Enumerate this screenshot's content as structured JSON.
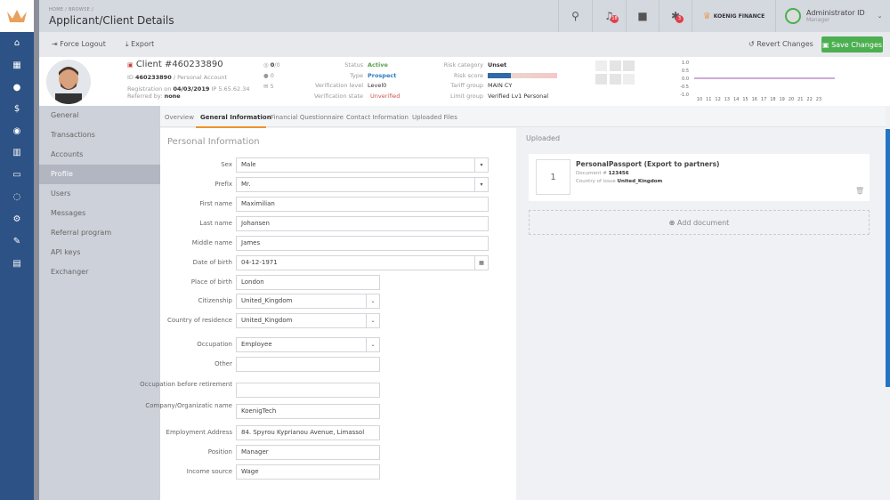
{
  "header": {
    "breadcrumb": "HOME / BROWSE /",
    "title": "Applicant/Client Details",
    "notifications_badge": "18",
    "alerts_badge": "3",
    "brand": "KOENIG FINANCE",
    "user_name": "Administrator ID",
    "user_role": "Manager"
  },
  "toolbar": {
    "force_logout": "Force Logout",
    "export": "Export",
    "revert": "Revert Changes",
    "save": "Save Changes"
  },
  "client": {
    "title": "Client #460233890",
    "id_label": "ID",
    "id": "460233890",
    "account_type": "/ Personal Account",
    "registration_label": "Registration on",
    "registration_date": "04/03/2019",
    "ip": "IP 5.65.62.34",
    "referred_label": "Referred by:",
    "referred": "none",
    "stat1": "0",
    "stat1_sub": "/0",
    "stat2": "0",
    "stat3": "5",
    "status_label": "Status",
    "status": "Active",
    "type_label": "Type",
    "type": "Prospect",
    "verification_level_label": "Verification level",
    "verification_level": "Level0",
    "verification_state_label": "Verification state",
    "verification_state": "Unverified",
    "risk_category_label": "Risk category",
    "risk_category": "Unset",
    "risk_score_label": "Risk score",
    "risk_score_fraction": 0.33,
    "tariff_label": "Tariff group",
    "tariff": "MAIN CY",
    "limit_label": "Limit group",
    "limit": "Verified Lv1 Personal"
  },
  "mini_chart": {
    "y_ticks": [
      "1.0",
      "0.5",
      "0.0",
      "-0.5",
      "-1.0"
    ],
    "x_ticks": [
      "10",
      "11",
      "12",
      "13",
      "14",
      "15",
      "16",
      "17",
      "18",
      "19",
      "20",
      "21",
      "22",
      "23"
    ]
  },
  "nav": [
    "General",
    "Transactions",
    "Accounts",
    "Profile",
    "Users",
    "Messages",
    "Referral program",
    "API keys",
    "Exchanger"
  ],
  "tabs": [
    "Overview",
    "General Information",
    "Financial Questionnaire",
    "Contact Information",
    "Uploaded Files"
  ],
  "section_title": "Personal Information",
  "fields": [
    {
      "label": "Sex",
      "value": "Male"
    },
    {
      "label": "Prefix",
      "value": "Mr."
    },
    {
      "label": "First name",
      "value": "Maximilian"
    },
    {
      "label": "Last name",
      "value": "Johansen"
    },
    {
      "label": "Middle name",
      "value": "James"
    },
    {
      "label": "Date of birth",
      "value": "04-12-1971"
    },
    {
      "label": "Place of birth",
      "value": "London"
    },
    {
      "label": "Citizenship",
      "value": "United_Kingdom"
    },
    {
      "label": "Country of residence",
      "value": "United_Kingdom"
    },
    {
      "label": "Occupation",
      "value": "Employee"
    },
    {
      "label": "Other",
      "value": ""
    },
    {
      "label": "Occupation before retirement",
      "value": ""
    },
    {
      "label": "Company/Organizatic name",
      "value": "KoenigTech"
    },
    {
      "label": "Employment Address",
      "value": "84. Spyrou Kyprianou Avenue, Limassol"
    },
    {
      "label": "Position",
      "value": "Manager"
    },
    {
      "label": "Income source",
      "value": "Wage"
    }
  ],
  "uploaded": {
    "title": "Uploaded",
    "doc_number_box": "1",
    "doc_title": "PersonalPassport (Export to partners)",
    "doc_num_label": "Document #",
    "doc_num": "123456",
    "country_label": "Country of issue",
    "country": "United_Kingdom",
    "add": "Add document"
  }
}
